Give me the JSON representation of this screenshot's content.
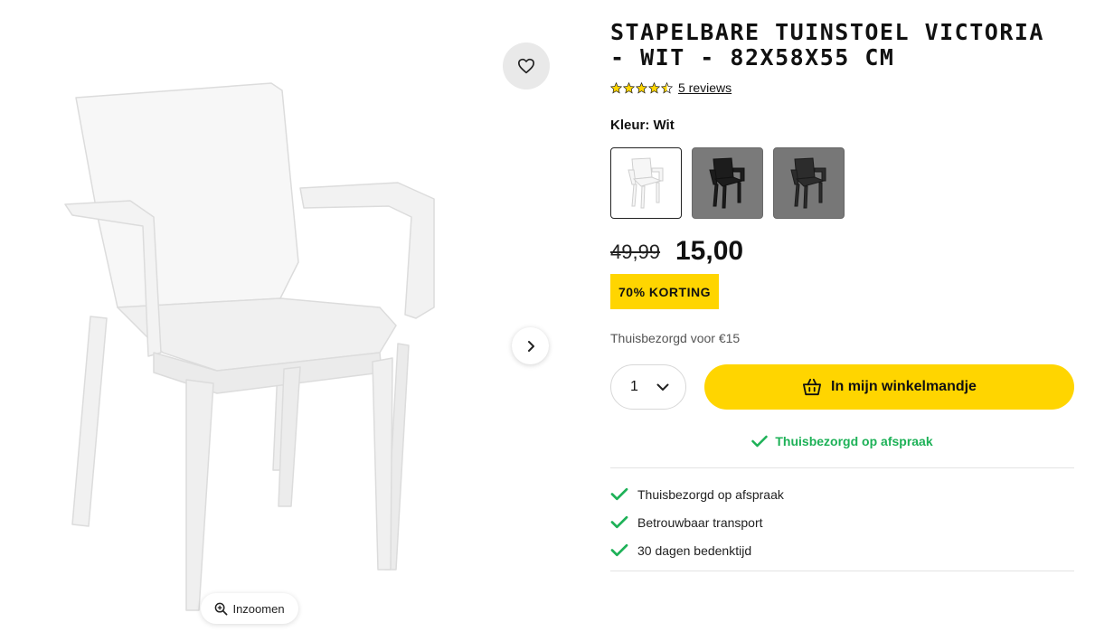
{
  "product": {
    "title": "Stapelbare tuinstoel Victoria - wit - 82x58x55 cm",
    "rating": 4.5,
    "reviews_label": "5 reviews",
    "color_label": "Kleur: Wit",
    "swatches": [
      {
        "name": "Wit",
        "selected": true
      },
      {
        "name": "Zwart",
        "selected": false
      },
      {
        "name": "Antraciet",
        "selected": false
      }
    ],
    "old_price": "49,99",
    "new_price": "15,00",
    "discount_badge": "70% KORTING",
    "delivery_cost": "Thuisbezorgd voor €15",
    "quantity": "1",
    "cart_button_label": "In mijn winkelmandje",
    "delivery_note": "Thuisbezorgd op afspraak",
    "usps": [
      "Thuisbezorgd op afspraak",
      "Betrouwbaar transport",
      "30 dagen bedenktijd"
    ]
  },
  "gallery": {
    "zoom_label": "Inzoomen"
  },
  "colors": {
    "accent": "#ffd500",
    "success": "#1db157",
    "star": "#ffd500"
  },
  "icons": {
    "favorite": "heart-icon",
    "next": "chevron-right-icon",
    "zoom": "zoom-in-icon",
    "cart": "basket-icon",
    "check": "check-icon",
    "dropdown": "chevron-down-icon"
  }
}
